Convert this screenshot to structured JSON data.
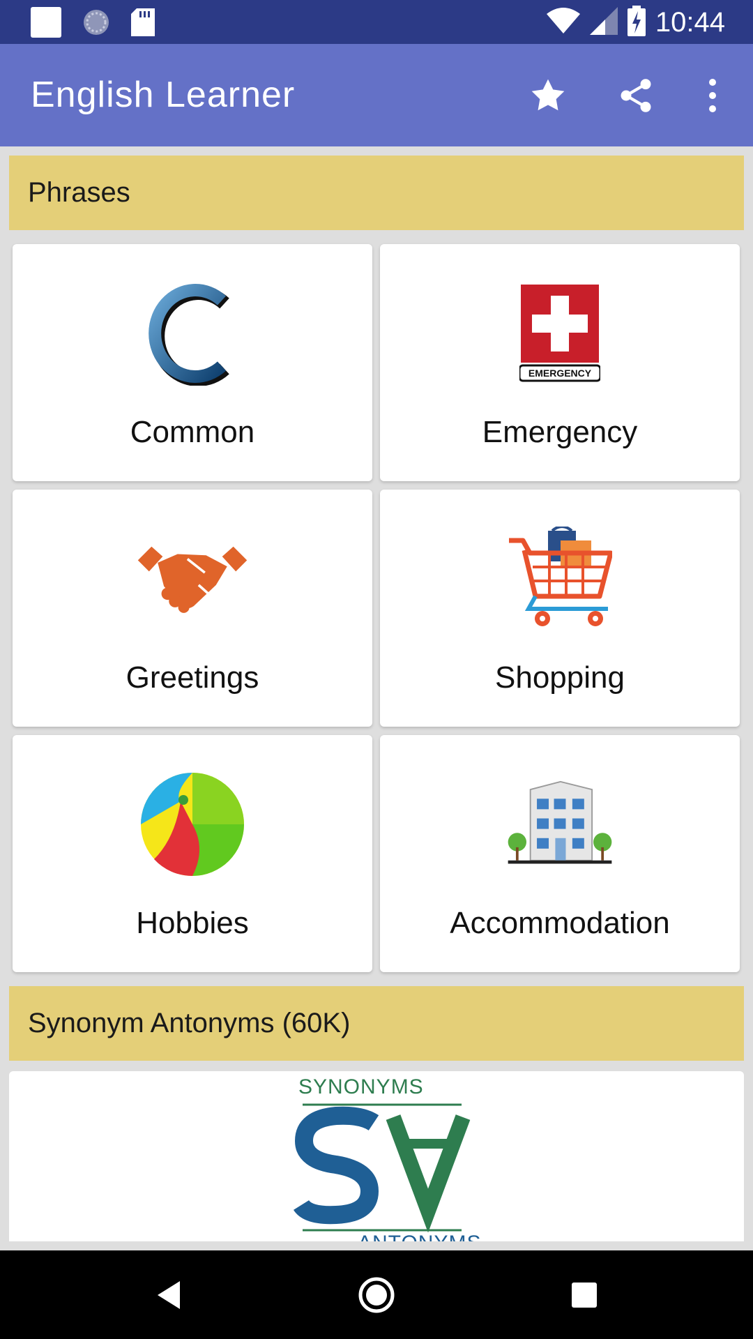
{
  "status_bar": {
    "time": "10:44",
    "left_icons": [
      "notification-square-icon",
      "sync-icon",
      "sd-card-icon"
    ],
    "right_icons": [
      "wifi-icon",
      "signal-icon",
      "battery-charging-icon"
    ]
  },
  "app_bar": {
    "title": "English Learner",
    "actions": [
      "star-icon",
      "share-icon",
      "more-vert-icon"
    ]
  },
  "sections": [
    {
      "title": "Phrases",
      "items": [
        {
          "label": "Common",
          "icon": "common-c-icon"
        },
        {
          "label": "Emergency",
          "icon": "emergency-icon"
        },
        {
          "label": "Greetings",
          "icon": "handshake-icon"
        },
        {
          "label": "Shopping",
          "icon": "shopping-cart-icon"
        },
        {
          "label": "Hobbies",
          "icon": "beach-ball-icon"
        },
        {
          "label": "Accommodation",
          "icon": "building-icon"
        }
      ]
    },
    {
      "title": "Synonym Antonyms (60K)",
      "banner": {
        "top_text": "SYNONYMS",
        "bottom_text": "ANTONYMS",
        "icon": "synonyms-antonyms-logo"
      }
    }
  ],
  "nav_bar": {
    "buttons": [
      "back-icon",
      "home-icon",
      "recents-icon"
    ]
  },
  "colors": {
    "status_bar": "#2c3a86",
    "app_bar": "#6471c7",
    "section_header": "#e4cf78",
    "background": "#dedede"
  }
}
